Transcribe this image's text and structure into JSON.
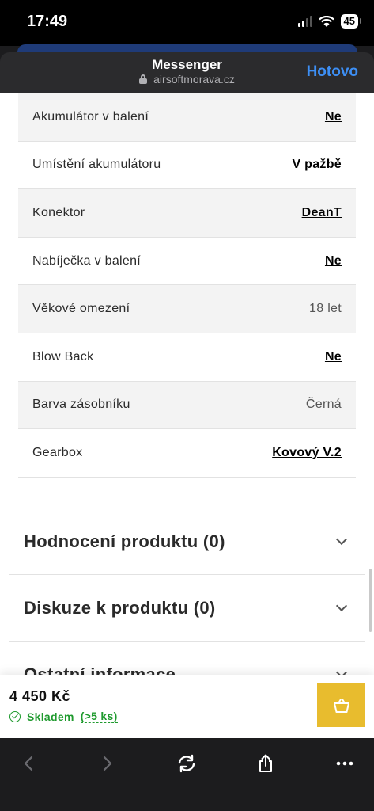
{
  "status": {
    "time": "17:49",
    "battery": "45"
  },
  "sheet": {
    "title": "Messenger",
    "domain": "airsoftmorava.cz",
    "done_label": "Hotovo"
  },
  "specs": [
    {
      "label": "Akumulátor v balení",
      "value": "Ne",
      "link": true
    },
    {
      "label": "Umístění akumulátoru",
      "value": "V pažbě",
      "link": true
    },
    {
      "label": "Konektor",
      "value": "DeanT",
      "link": true
    },
    {
      "label": "Nabíječka v balení",
      "value": "Ne",
      "link": true
    },
    {
      "label": "Věkové omezení",
      "value": "18 let",
      "link": false
    },
    {
      "label": "Blow Back",
      "value": "Ne",
      "link": true
    },
    {
      "label": "Barva zásobníku",
      "value": "Černá",
      "link": false
    },
    {
      "label": "Gearbox",
      "value": "Kovový V.2",
      "link": true
    }
  ],
  "accordion": [
    {
      "title": "Hodnocení produktu (0)"
    },
    {
      "title": "Diskuze k produktu (0)"
    },
    {
      "title": "Ostatní informace"
    }
  ],
  "buybar": {
    "price": "4 450 Kč",
    "stock_label": "Skladem",
    "stock_qty": "(>5 ks)",
    "accent": "#e8bc2e",
    "stock_color": "#1f9a2e"
  },
  "toolbar": {
    "icons": [
      "back-icon",
      "forward-icon",
      "reload-icon",
      "share-icon",
      "more-icon"
    ]
  }
}
